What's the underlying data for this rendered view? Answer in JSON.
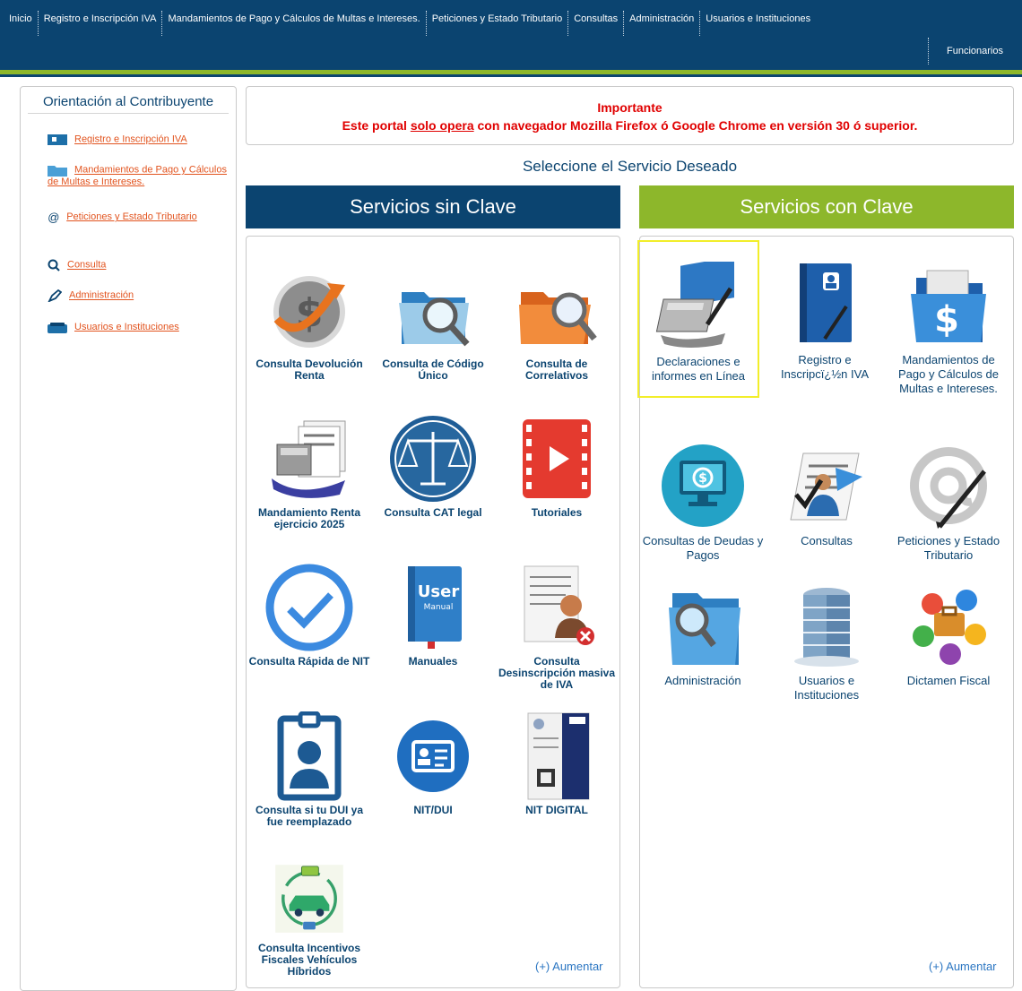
{
  "nav": {
    "items": [
      "Inicio",
      "Registro e Inscripción IVA",
      "Mandamientos de Pago y Cálculos de Multas e Intereses.",
      "Peticiones y Estado Tributario",
      "Consultas",
      "Administración",
      "Usuarios e Instituciones"
    ],
    "funcionarios": "Funcionarios"
  },
  "sidebar": {
    "title": "Orientación al Contribuyente",
    "items": [
      {
        "label": "Registro e Inscripción IVA",
        "icon": "registro-icon"
      },
      {
        "label": "Mandamientos de Pago y Cálculos de Multas e Intereses.",
        "icon": "folder-icon"
      },
      {
        "label": "Peticiones y Estado Tributario",
        "icon": "at-icon"
      },
      {
        "label": "Consulta",
        "icon": "search-icon"
      },
      {
        "label": "Administración",
        "icon": "pen-icon"
      },
      {
        "label": "Usuarios e Instituciones",
        "icon": "building-icon"
      }
    ]
  },
  "important": {
    "title": "Importante",
    "line_pre": "Este portal ",
    "line_underline": "solo opera",
    "line_post": " con navegador Mozilla Firefox ó Google Chrome en versión 30 ó superior."
  },
  "select_title": "Seleccione el Servicio Deseado",
  "sin_clave": {
    "header": "Servicios sin Clave",
    "tiles": [
      {
        "label": "Consulta Devolución Renta",
        "icon": "money-refund-icon"
      },
      {
        "label": "Consulta de Código Único",
        "icon": "folder-search-icon"
      },
      {
        "label": "Consulta de Correlativos",
        "icon": "orange-folder-search-icon"
      },
      {
        "label": "Mandamiento Renta ejercicio 2025",
        "icon": "calculator-docs-icon"
      },
      {
        "label": "Consulta CAT legal",
        "icon": "scales-icon"
      },
      {
        "label": "Tutoriales",
        "icon": "video-play-icon"
      },
      {
        "label": "Consulta Rápida de NIT",
        "icon": "checkmark-circle-icon"
      },
      {
        "label": "Manuales",
        "icon": "user-manual-icon"
      },
      {
        "label": "Consulta Desinscripción masiva de IVA",
        "icon": "document-user-remove-icon"
      },
      {
        "label": "Consulta si tu DUI ya fue reemplazado",
        "icon": "id-badge-icon"
      },
      {
        "label": "NIT/DUI",
        "icon": "id-card-circle-icon"
      },
      {
        "label": "NIT DIGITAL",
        "icon": "nit-card-icon"
      },
      {
        "label": "Consulta Incentivos Fiscales Vehículos Híbridos",
        "icon": "hybrid-car-icon"
      }
    ],
    "aumentar": "(+) Aumentar"
  },
  "con_clave": {
    "header": "Servicios con Clave",
    "tiles": [
      {
        "label": "Declaraciones e informes en Línea",
        "icon": "calculator-pen-icon"
      },
      {
        "label": "Registro e Inscripcï¿½n IVA",
        "icon": "blue-book-user-icon"
      },
      {
        "label": "Mandamientos de Pago y Cálculos de Multas e Intereses.",
        "icon": "folder-money-icon"
      },
      {
        "label": "Consultas de Deudas y Pagos",
        "icon": "monitor-money-icon"
      },
      {
        "label": "Consultas",
        "icon": "checklist-user-icon"
      },
      {
        "label": "Peticiones y Estado Tributario",
        "icon": "at-pen-icon"
      },
      {
        "label": "Administración",
        "icon": "folder-magnifier-icon"
      },
      {
        "label": "Usuarios e Instituciones",
        "icon": "buildings-icon"
      },
      {
        "label": "Dictamen Fiscal",
        "icon": "briefcase-docs-icon"
      }
    ],
    "aumentar": "(+) Aumentar"
  },
  "colors": {
    "navy": "#0b4470",
    "green": "#8db72b",
    "orange": "#e2541f",
    "red": "#e00000",
    "highlight": "#f2ee2a"
  }
}
